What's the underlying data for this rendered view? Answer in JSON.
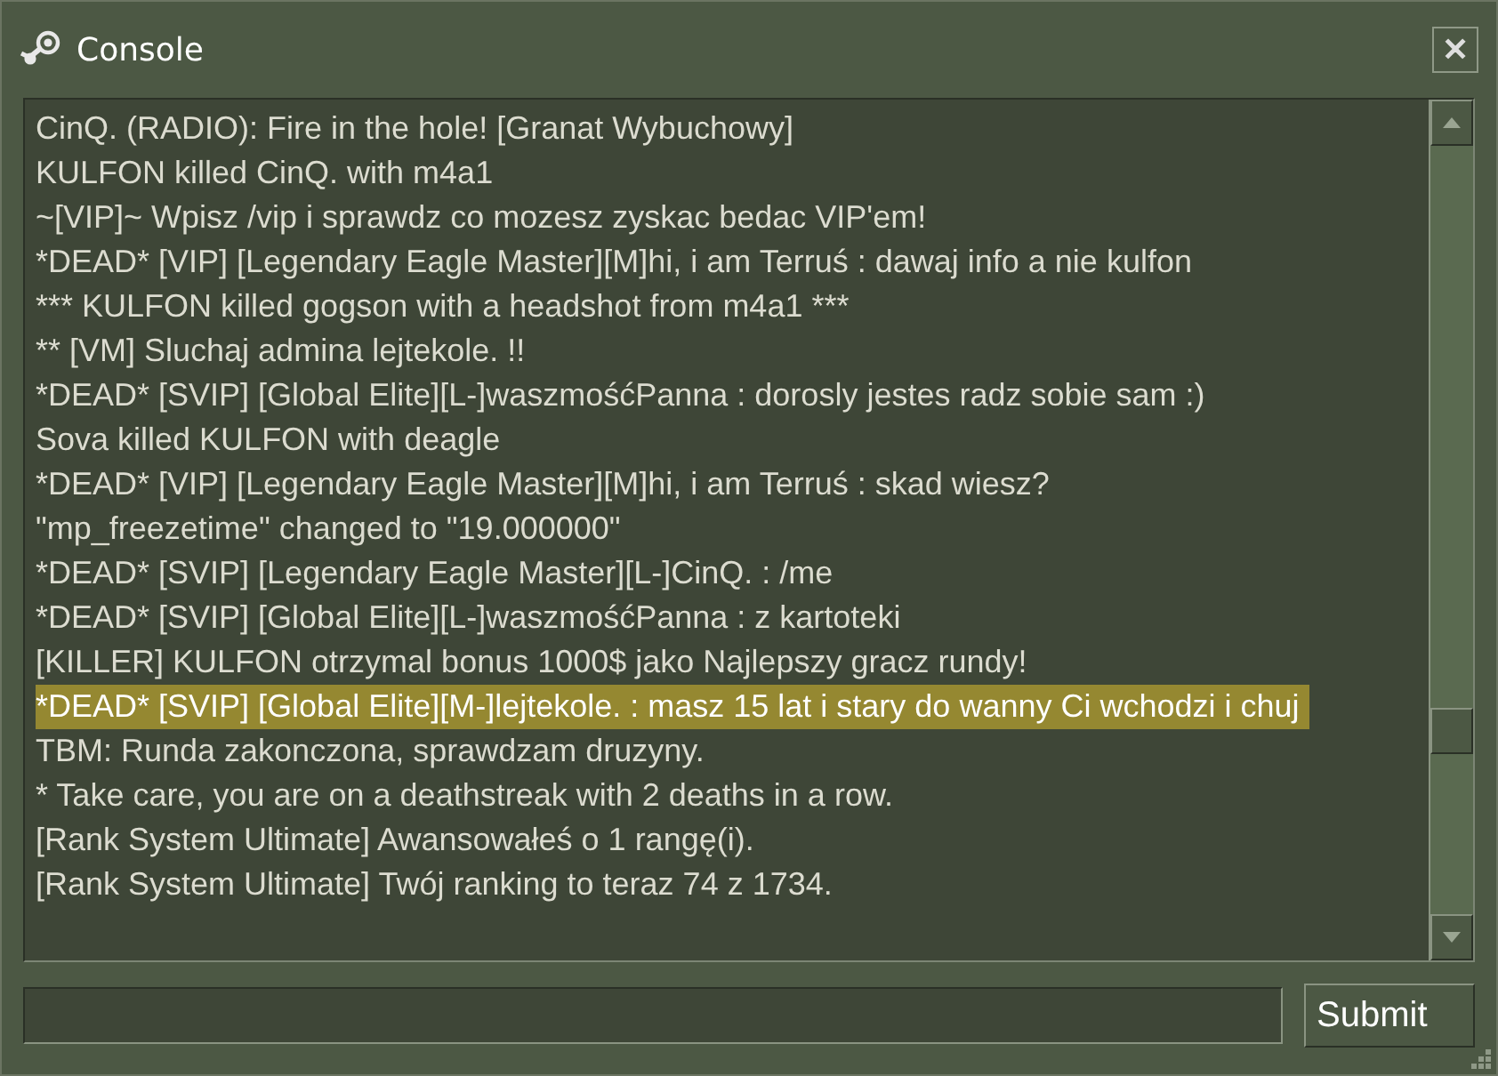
{
  "window": {
    "title": "Console",
    "close": "✕"
  },
  "log": [
    {
      "text": "CinQ. (RADIO): Fire in the hole! [Granat Wybuchowy]",
      "selected": false
    },
    {
      "text": "KULFON killed CinQ. with m4a1",
      "selected": false
    },
    {
      "text": "~[VIP]~ Wpisz /vip i sprawdz co mozesz zyskac bedac VIP'em!",
      "selected": false
    },
    {
      "text": "*DEAD* [VIP] [Legendary Eagle Master][M]hi, i am Terruś : dawaj info a nie kulfon",
      "selected": false
    },
    {
      "text": "*** KULFON killed gogson with a headshot from m4a1 ***",
      "selected": false
    },
    {
      "text": "** [VM] Sluchaj admina lejtekole. !!",
      "selected": false
    },
    {
      "text": "*DEAD* [SVIP] [Global Elite][L-]waszmośćPanna : dorosly jestes radz sobie sam :)",
      "selected": false
    },
    {
      "text": "Sova killed KULFON with deagle",
      "selected": false
    },
    {
      "text": "*DEAD* [VIP] [Legendary Eagle Master][M]hi, i am Terruś : skad wiesz?",
      "selected": false
    },
    {
      "text": "\"mp_freezetime\" changed to \"19.000000\"",
      "selected": false
    },
    {
      "text": "*DEAD* [SVIP] [Legendary Eagle Master][L-]CinQ. : /me",
      "selected": false
    },
    {
      "text": "*DEAD* [SVIP] [Global Elite][L-]waszmośćPanna : z kartoteki",
      "selected": false
    },
    {
      "text": "[KILLER] KULFON otrzymal bonus 1000$ jako Najlepszy gracz rundy!",
      "selected": false
    },
    {
      "text": "*DEAD* [SVIP] [Global Elite][M-]lejtekole. : masz 15 lat i stary do wanny Ci wchodzi i chuj",
      "selected": true
    },
    {
      "text": "TBM: Runda zakonczona, sprawdzam druzyny.",
      "selected": false
    },
    {
      "text": "* Take care, you are on a deathstreak with 2 deaths in a row.",
      "selected": false
    },
    {
      "text": "[Rank System Ultimate] Awansowałeś o 1 rangę(i).",
      "selected": false
    },
    {
      "text": "[Rank System Ultimate] Twój ranking to teraz 74 z 1734.",
      "selected": false
    }
  ],
  "submit": "Submit"
}
